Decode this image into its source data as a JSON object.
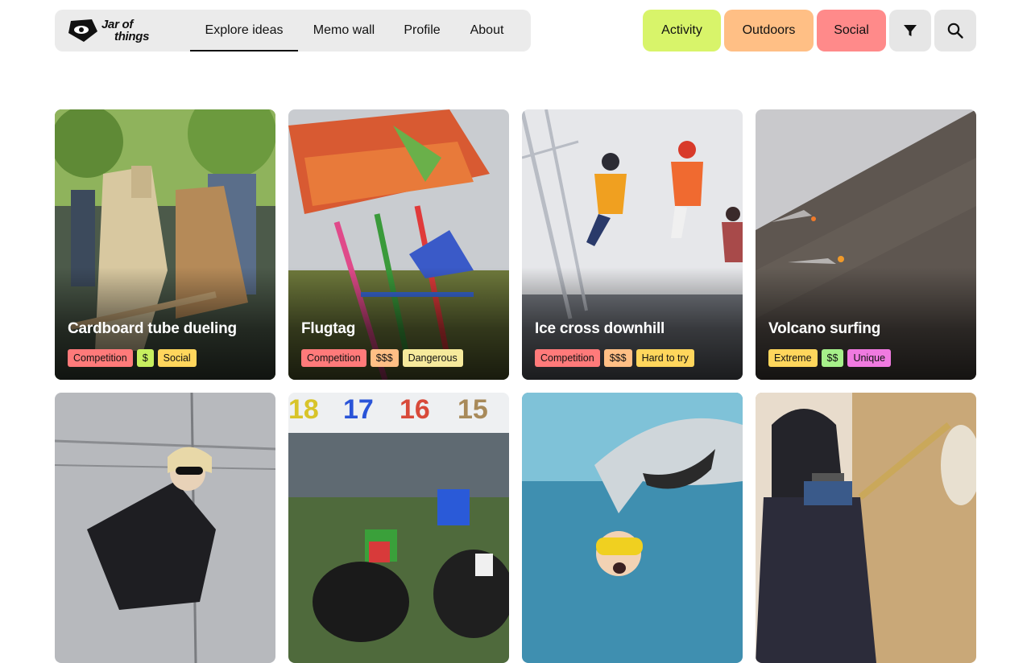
{
  "brand": {
    "line1": "Jar of",
    "line2": "things"
  },
  "nav": {
    "items": [
      {
        "label": "Explore ideas",
        "active": true
      },
      {
        "label": "Memo wall",
        "active": false
      },
      {
        "label": "Profile",
        "active": false
      },
      {
        "label": "About",
        "active": false
      }
    ]
  },
  "filters": {
    "chips": [
      {
        "label": "Activity",
        "color": "#d8f46a"
      },
      {
        "label": "Outdoors",
        "color": "#ffbf85"
      },
      {
        "label": "Social",
        "color": "#ff8a8a"
      }
    ],
    "filter_icon": "filter-funnel-icon",
    "search_icon": "search-icon"
  },
  "cards": [
    {
      "title": "Cardboard tube dueling",
      "tags": [
        {
          "label": "Competition",
          "color": "#ff7a7a"
        },
        {
          "label": "$",
          "color": "#c7ef5f"
        },
        {
          "label": "Social",
          "color": "#ffd65c"
        }
      ]
    },
    {
      "title": "Flugtag",
      "tags": [
        {
          "label": "Competition",
          "color": "#ff7a7a"
        },
        {
          "label": "$$$",
          "color": "#ffbf85"
        },
        {
          "label": "Dangerous",
          "color": "#f6ea9c"
        }
      ]
    },
    {
      "title": "Ice cross downhill",
      "tags": [
        {
          "label": "Competition",
          "color": "#ff7a7a"
        },
        {
          "label": "$$$",
          "color": "#ffbf85"
        },
        {
          "label": "Hard to try",
          "color": "#ffd65c"
        }
      ]
    },
    {
      "title": "Volcano surfing",
      "tags": [
        {
          "label": "Extreme",
          "color": "#ffd65c"
        },
        {
          "label": "$$",
          "color": "#a6f08a"
        },
        {
          "label": "Unique",
          "color": "#f07ae0"
        }
      ]
    },
    {
      "title": "",
      "tags": []
    },
    {
      "title": "",
      "tags": []
    },
    {
      "title": "",
      "tags": []
    },
    {
      "title": "",
      "tags": []
    }
  ]
}
